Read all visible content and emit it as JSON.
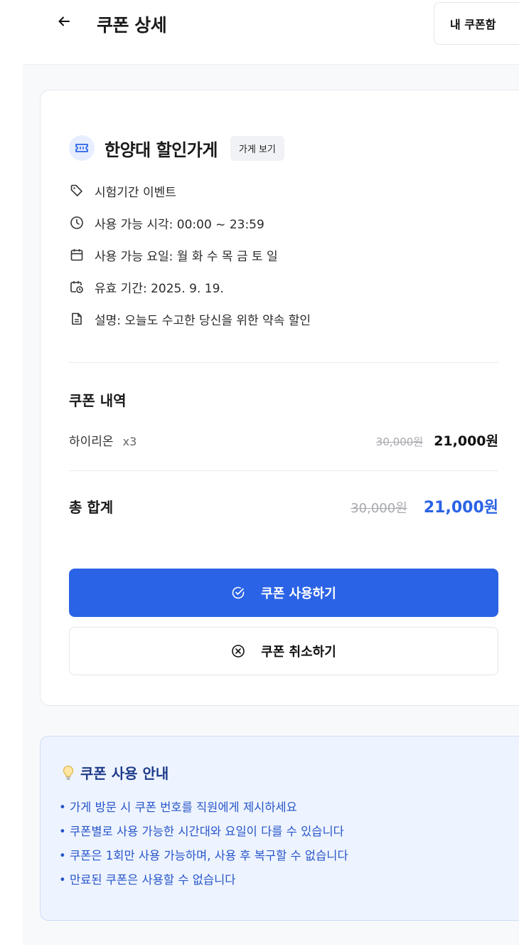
{
  "header": {
    "back_icon": "arrow-left-icon",
    "title": "쿠폰 상세",
    "my_coupons_label": "내 쿠폰함"
  },
  "store": {
    "icon": "ticket-icon",
    "name": "한양대 할인가게",
    "view_store_label": "가게 보기"
  },
  "info": [
    {
      "icon": "tag-icon",
      "text": "시험기간 이벤트"
    },
    {
      "icon": "clock-icon",
      "text": "사용 가능 시각: 00:00 ~ 23:59"
    },
    {
      "icon": "calendar-icon",
      "text": "사용 가능 요일: 월 화 수 목 금 토 일"
    },
    {
      "icon": "calendar-clock-icon",
      "text": "유효 기간: 2025. 9. 19."
    },
    {
      "icon": "document-icon",
      "text": "설명: 오늘도 수고한 당신을 위한 약속 할인"
    }
  ],
  "coupon_details": {
    "title": "쿠폰 내역",
    "items": [
      {
        "name": "하이리온",
        "qty": "x3",
        "original_price": "30,000원",
        "price": "21,000원"
      }
    ]
  },
  "total": {
    "label": "총 합계",
    "original_price": "30,000원",
    "price": "21,000원"
  },
  "actions": {
    "use_label": "쿠폰 사용하기",
    "cancel_label": "쿠폰 취소하기"
  },
  "notice": {
    "icon": "lightbulb-icon",
    "title": "쿠폰 사용 안내",
    "items": [
      "• 가게 방문 시 쿠폰 번호를 직원에게 제시하세요",
      "• 쿠폰별로 사용 가능한 시간대와 요일이 다를 수 있습니다",
      "• 쿠폰은 1회만 사용 가능하며, 사용 후 복구할 수 없습니다",
      "• 만료된 쿠폰은 사용할 수 없습니다"
    ]
  },
  "colors": {
    "primary": "#2b63e6",
    "notice_bg": "#eef4ff",
    "notice_text": "#2755c9",
    "strike": "#a7a9ad"
  }
}
